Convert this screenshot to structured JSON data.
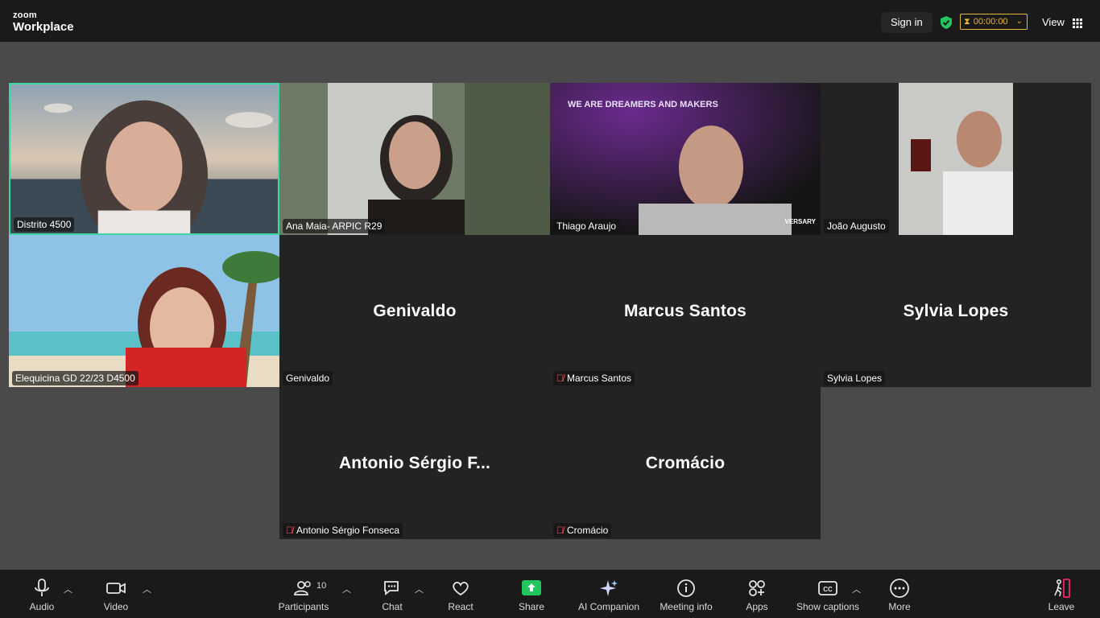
{
  "app": {
    "logo_line1": "zoom",
    "logo_line2": "Workplace"
  },
  "header": {
    "sign_in": "Sign in",
    "timer": "00:00:00",
    "view": "View"
  },
  "tiles": [
    {
      "name": "Distrito 4500",
      "muted": false,
      "video": true
    },
    {
      "name": "Ana Maia- ARPIC R29",
      "muted": false,
      "video": true
    },
    {
      "name": "Thiago Araujo",
      "muted": false,
      "video": true,
      "overlay_text": "WE ARE DREAMERS AND MAKERS",
      "overlay_corner": "VERSARY"
    },
    {
      "name": "João Augusto",
      "muted": false,
      "video": true
    },
    {
      "name": "Elequicina GD 22/23 D4500",
      "muted": false,
      "video": true
    },
    {
      "name": "Genivaldo",
      "display": "Genivaldo",
      "muted": false,
      "video": false
    },
    {
      "name": "Marcus Santos",
      "display": "Marcus Santos",
      "muted": true,
      "video": false
    },
    {
      "name": "Sylvia Lopes",
      "display": "Sylvia Lopes",
      "muted": false,
      "video": false
    },
    {
      "name": "Antonio Sérgio Fonseca",
      "display": "Antonio Sérgio F...",
      "muted": true,
      "video": false
    },
    {
      "name": "Cromácio",
      "display": "Cromácio",
      "muted": true,
      "video": false
    }
  ],
  "toolbar": {
    "audio": "Audio",
    "video": "Video",
    "participants": "Participants",
    "participants_count": "10",
    "chat": "Chat",
    "react": "React",
    "share": "Share",
    "ai_companion": "AI Companion",
    "meeting_info": "Meeting info",
    "apps": "Apps",
    "show_captions": "Show captions",
    "more": "More",
    "leave": "Leave"
  },
  "colors": {
    "active_speaker": "#3ed6a3",
    "share": "#22c55e",
    "timer": "#e8b740",
    "muted": "#ff5c5c",
    "leave": "#e0245e"
  }
}
